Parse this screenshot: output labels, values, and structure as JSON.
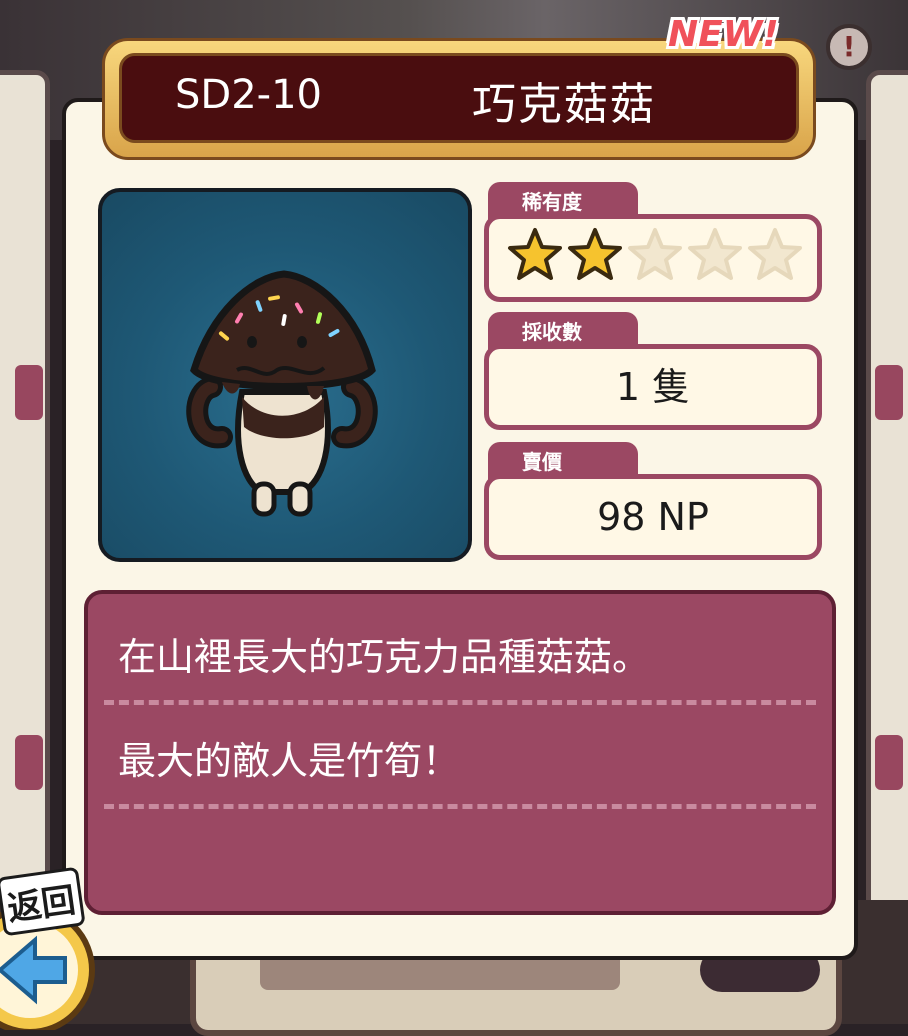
{
  "item": {
    "code": "SD2-10",
    "name": "巧克菇菇",
    "new_badge": "NEW!",
    "alert_glyph": "!"
  },
  "stats": {
    "rarity_label": "稀有度",
    "rarity_stars": 2,
    "rarity_max": 5,
    "collected_label": "採收數",
    "collected_value": "1 隻",
    "price_label": "賣價",
    "price_value": "98 NP"
  },
  "description": {
    "line1": "在山裡長大的巧克力品種菇菇。",
    "line2": "最大的敵人是竹筍！"
  },
  "nav": {
    "back_label": "返回"
  },
  "colors": {
    "accent": "#9b4863",
    "title_bg": "#4a0d0f",
    "portrait_bg": "#1e5875",
    "star_filled": "#f6c32e",
    "star_empty": "#f2e7cf"
  }
}
